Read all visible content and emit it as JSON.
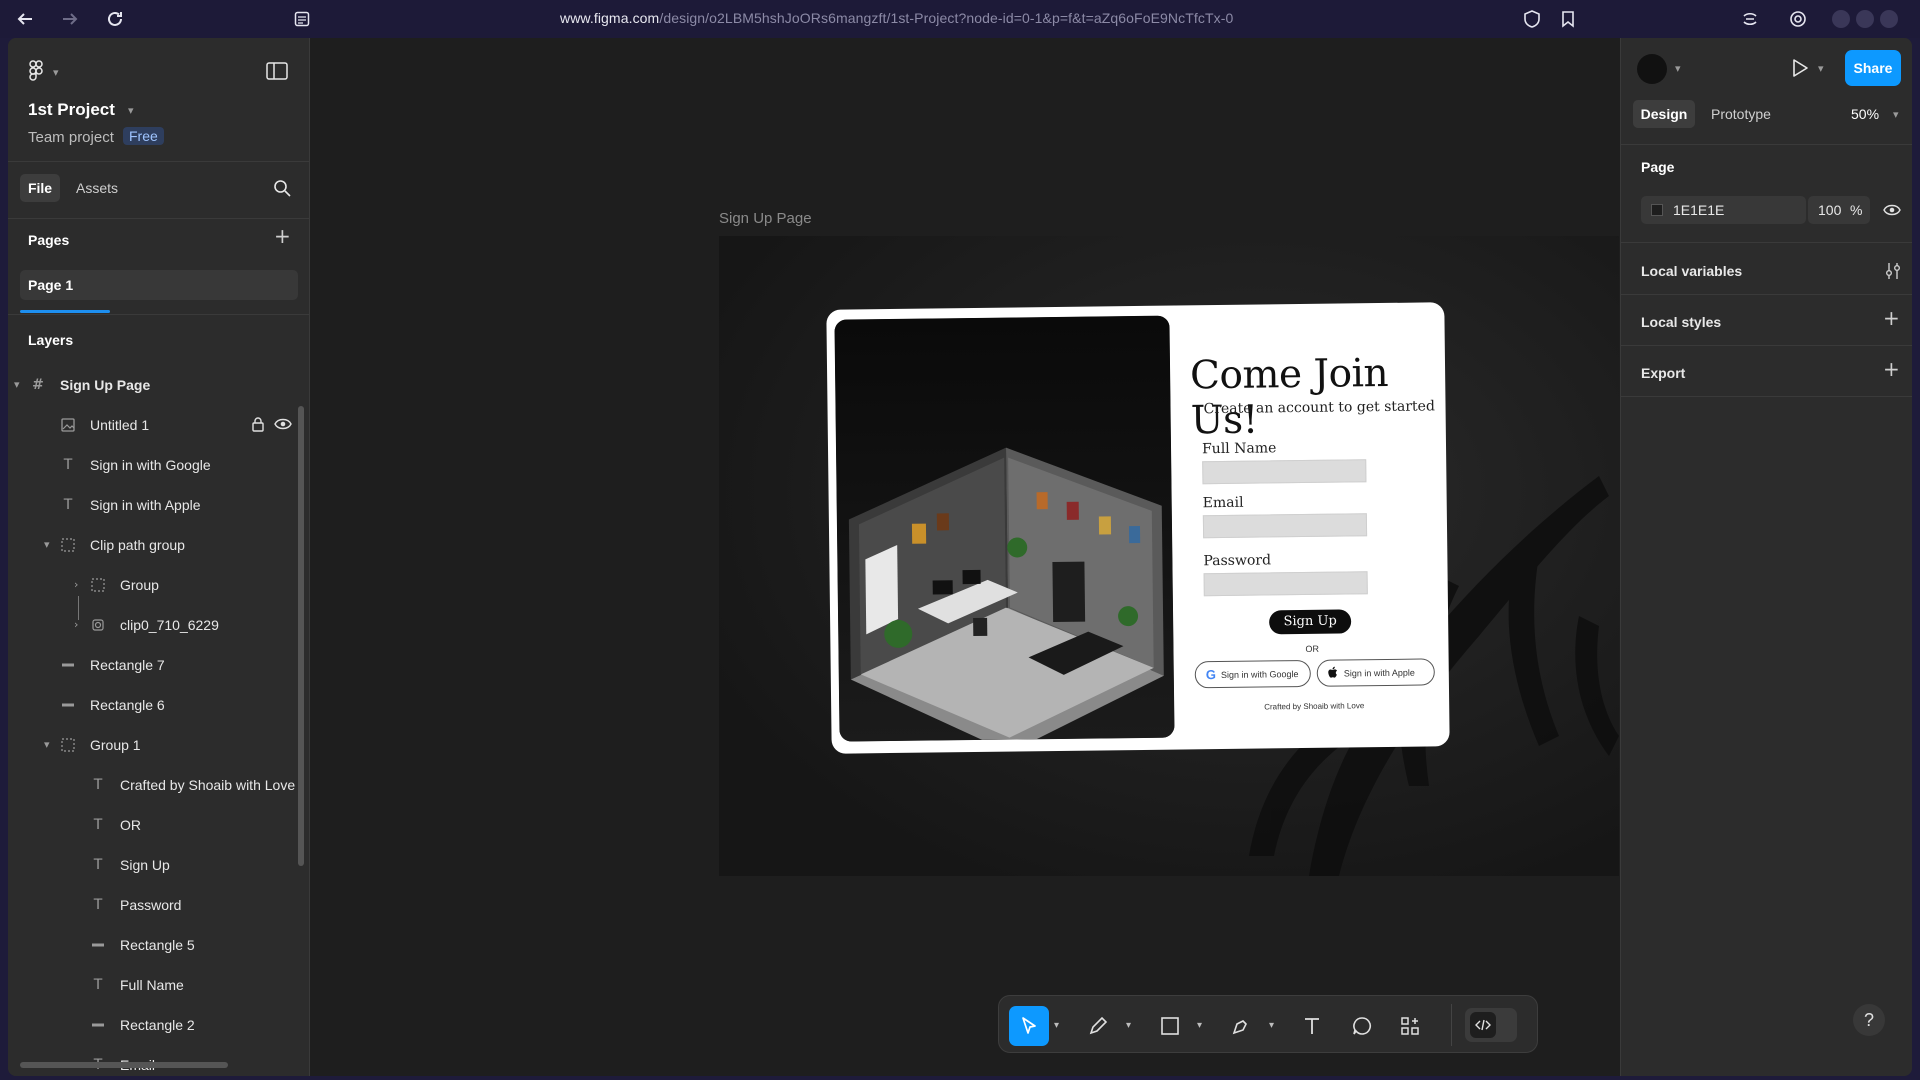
{
  "browser": {
    "url_domain": "www.figma.com",
    "url_path": "/design/o2LBM5hshJoORs6mangzft/1st-Project?node-id=0-1&p=f&t=aZq6oFoE9NcTfcTx-0"
  },
  "left_panel": {
    "project_title": "1st Project",
    "project_subtitle": "Team project",
    "plan_badge": "Free",
    "tabs": {
      "file": "File",
      "assets": "Assets"
    },
    "pages_heading": "Pages",
    "pages": [
      "Page 1"
    ],
    "layers_heading": "Layers",
    "layers": [
      {
        "label": "Sign Up Page",
        "icon": "frame-icon"
      },
      {
        "label": "Untitled 1",
        "icon": "image-icon"
      },
      {
        "label": "Sign in with Google",
        "icon": "text-icon"
      },
      {
        "label": "Sign in with Apple",
        "icon": "text-icon"
      },
      {
        "label": "Clip path group",
        "icon": "group-icon"
      },
      {
        "label": "Group",
        "icon": "group-icon"
      },
      {
        "label": "clip0_710_6229",
        "icon": "clip-icon"
      },
      {
        "label": "Rectangle 7",
        "icon": "rectangle-icon"
      },
      {
        "label": "Rectangle 6",
        "icon": "rectangle-icon"
      },
      {
        "label": "Group 1",
        "icon": "group-icon"
      },
      {
        "label": "Crafted by Shoaib with Love",
        "icon": "text-icon"
      },
      {
        "label": "OR",
        "icon": "text-icon"
      },
      {
        "label": "Sign Up",
        "icon": "text-icon"
      },
      {
        "label": "Password",
        "icon": "text-icon"
      },
      {
        "label": "Rectangle 5",
        "icon": "rectangle-icon"
      },
      {
        "label": "Full Name",
        "icon": "text-icon"
      },
      {
        "label": "Rectangle 2",
        "icon": "rectangle-icon"
      },
      {
        "label": "Email",
        "icon": "text-icon"
      }
    ]
  },
  "canvas": {
    "frame_label": "Sign Up Page",
    "design": {
      "title": "Come Join Us!",
      "subtitle": "Create an account to get started",
      "full_name_label": "Full Name",
      "email_label": "Email",
      "password_label": "Password",
      "signup_button": "Sign Up",
      "or_text": "OR",
      "google_button": "Sign in with Google",
      "apple_button": "Sign in  with Apple",
      "footer": "Crafted by Shoaib with Love"
    }
  },
  "right_panel": {
    "share_label": "Share",
    "tabs": {
      "design": "Design",
      "prototype": "Prototype"
    },
    "zoom": "50%",
    "page_heading": "Page",
    "page_color_hex": "1E1E1E",
    "page_opacity": "100",
    "percent_sign": "%",
    "local_variables": "Local variables",
    "local_styles": "Local styles",
    "export": "Export",
    "help": "?"
  },
  "colors": {
    "accent": "#0d99ff",
    "canvas_bg": "#1e1e1e",
    "panel_bg": "#2c2c2c"
  }
}
